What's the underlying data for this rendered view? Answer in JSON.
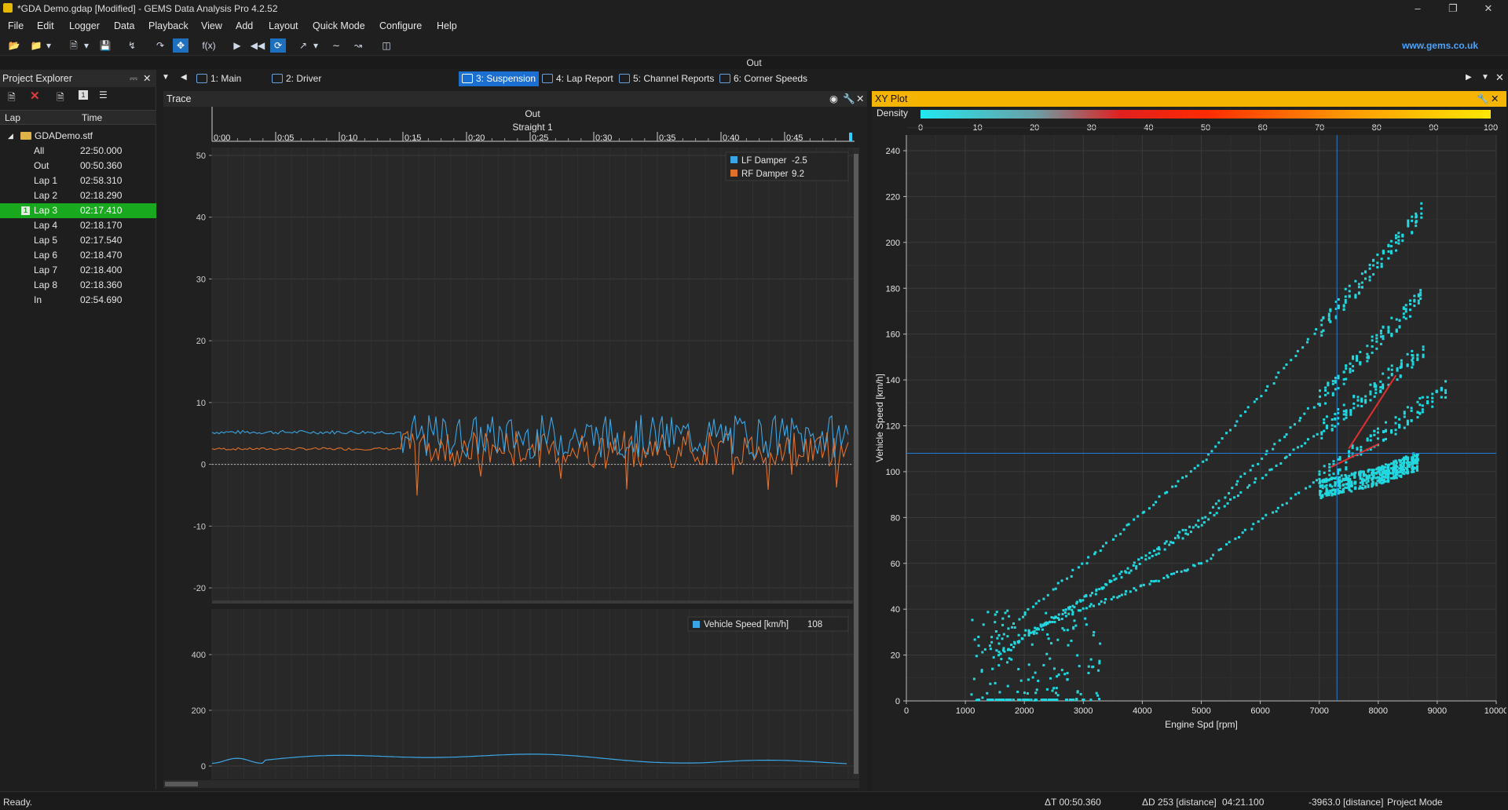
{
  "window": {
    "title": "*GDA Demo.gdap [Modified] - GEMS Data Analysis Pro 4.2.52"
  },
  "menu": [
    "File",
    "Edit",
    "Logger",
    "Data",
    "Playback",
    "View",
    "Add",
    "Layout",
    "Quick Mode",
    "Configure",
    "Help"
  ],
  "toolbar": {
    "website": "www.gems.co.uk",
    "fx_label": "f(x)"
  },
  "out_label": "Out",
  "tabs": [
    "1: Main",
    "2: Driver",
    "3: Suspension",
    "4: Lap Report",
    "5: Channel Reports",
    "6: Corner Speeds"
  ],
  "explorer": {
    "title": "Project Explorer",
    "columns": [
      "Lap",
      "Time"
    ],
    "root": "GDADemo.stf",
    "laps": [
      {
        "name": "All",
        "time": "22:50.000"
      },
      {
        "name": "Out",
        "time": "00:50.360"
      },
      {
        "name": "Lap 1",
        "time": "02:58.310"
      },
      {
        "name": "Lap 2",
        "time": "02:18.290"
      },
      {
        "name": "Lap 3",
        "time": "02:17.410",
        "selected": true
      },
      {
        "name": "Lap 4",
        "time": "02:18.170"
      },
      {
        "name": "Lap 5",
        "time": "02:17.540"
      },
      {
        "name": "Lap 6",
        "time": "02:18.470"
      },
      {
        "name": "Lap 7",
        "time": "02:18.400"
      },
      {
        "name": "Lap 8",
        "time": "02:18.360"
      },
      {
        "name": "In",
        "time": "02:54.690"
      }
    ],
    "selected_badge": "1"
  },
  "trace": {
    "title": "Trace",
    "lap_label": "Out",
    "segment_label": "Straight 1",
    "time_ticks": [
      "0:00",
      "0:05",
      "0:10",
      "0:15",
      "0:20",
      "0:25",
      "0:30",
      "0:35",
      "0:40",
      "0:45"
    ],
    "upper_y_ticks": [
      "50",
      "40",
      "30",
      "20",
      "10",
      "0",
      "-10",
      "-20"
    ],
    "lower_y_ticks": [
      "400",
      "200",
      "0"
    ],
    "legend_upper": [
      {
        "name": "LF Damper",
        "value": "-2.5",
        "color": "#3aa6e6"
      },
      {
        "name": "RF Damper",
        "value": "9.2",
        "color": "#e0702a"
      }
    ],
    "legend_lower": [
      {
        "name": "Vehicle Speed [km/h]",
        "value": "108",
        "color": "#3aa6e6"
      }
    ]
  },
  "xy": {
    "title": "XY Plot",
    "density_label": "Density",
    "density_ticks": [
      "0",
      "10",
      "20",
      "30",
      "40",
      "50",
      "60",
      "70",
      "80",
      "90",
      "100"
    ],
    "x_label": "Engine Spd [rpm]",
    "y_label": "Vehicle Speed [km/h]",
    "x_ticks": [
      "0",
      "1000",
      "2000",
      "3000",
      "4000",
      "5000",
      "6000",
      "7000",
      "8000",
      "9000",
      "10000"
    ],
    "y_ticks": [
      "0",
      "20",
      "40",
      "60",
      "80",
      "100",
      "120",
      "140",
      "160",
      "180",
      "200",
      "220",
      "240"
    ],
    "point_color": "#22d8e0",
    "cursor": {
      "x_rpm": 7300,
      "y_kmh": 108
    }
  },
  "chart_data": {
    "type": "scatter",
    "title": "XY Plot",
    "xlabel": "Engine Spd [rpm]",
    "ylabel": "Vehicle Speed [km/h]",
    "xlim": [
      0,
      10000
    ],
    "ylim": [
      0,
      250
    ],
    "gear_lines": [
      {
        "x": [
          1200,
          5000,
          8800
        ],
        "y": [
          20,
          104,
          215
        ]
      },
      {
        "x": [
          1500,
          5000,
          8800
        ],
        "y": [
          19,
          79,
          178
        ]
      },
      {
        "x": [
          1600,
          5000,
          8800
        ],
        "y": [
          21,
          77,
          154
        ]
      },
      {
        "x": [
          2000,
          5000,
          9200
        ],
        "y": [
          30,
          60,
          137
        ]
      },
      {
        "x": [
          7000,
          8000,
          8700
        ],
        "y": [
          92,
          98,
          105
        ]
      }
    ]
  },
  "status": {
    "ready": "Ready.",
    "delta_t": "ΔT 00:50.360",
    "delta_d": "ΔD 253 [distance]",
    "time": "04:21.100",
    "distance": "-3963.0 [distance]",
    "mode": "Project Mode"
  }
}
